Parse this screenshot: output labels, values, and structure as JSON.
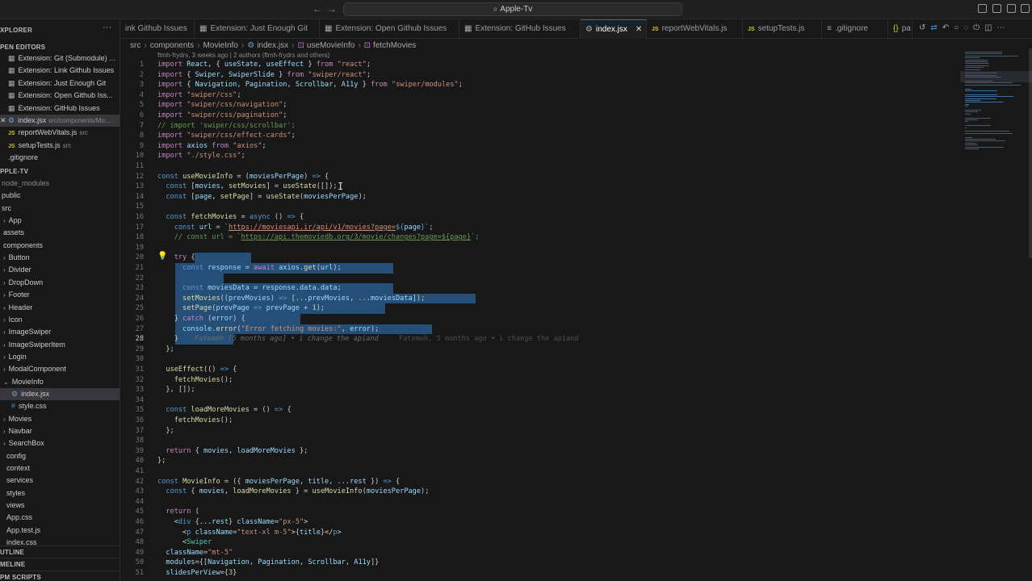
{
  "window": {
    "title": "Apple-Tv"
  },
  "sidebar": {
    "explorer_title": "XPLORER",
    "open_editors_title": "PEN EDITORS",
    "open_editors": [
      {
        "label": "Extension: Git (Submodule) ...",
        "desc": "",
        "icon": "ext"
      },
      {
        "label": "Extension: Link Github Issues",
        "desc": "",
        "icon": "ext"
      },
      {
        "label": "Extension: Just Enough Git",
        "desc": "",
        "icon": "ext"
      },
      {
        "label": "Extension: Open Github Iss...",
        "desc": "",
        "icon": "ext"
      },
      {
        "label": "Extension: GitHub Issues",
        "desc": "",
        "icon": "ext"
      },
      {
        "label": "index.jsx",
        "desc": "src/components/Mo...",
        "icon": "gear",
        "active": true
      },
      {
        "label": "reportWebVitals.js",
        "desc": "src",
        "icon": "js"
      },
      {
        "label": "setupTests.js",
        "desc": "src",
        "icon": "js"
      },
      {
        "label": ".gitignore",
        "desc": "",
        "icon": "none"
      }
    ],
    "project_title": "PPLE-TV",
    "tree": [
      {
        "label": "node_modules",
        "dim": true
      },
      {
        "label": "public"
      },
      {
        "label": "src"
      },
      {
        "label": "App",
        "chev": true
      },
      {
        "label": "assets"
      },
      {
        "label": "components"
      },
      {
        "label": "Button",
        "chev": true
      },
      {
        "label": "Divider",
        "chev": true
      },
      {
        "label": "DropDown",
        "chev": true
      },
      {
        "label": "Footer",
        "chev": true
      },
      {
        "label": "Header",
        "chev": true
      },
      {
        "label": "Icon",
        "chev": true
      },
      {
        "label": "ImageSwiper",
        "chev": true
      },
      {
        "label": "ImageSwiperItem",
        "chev": true
      },
      {
        "label": "Login",
        "chev": true
      },
      {
        "label": "ModalComponent",
        "chev": true
      },
      {
        "label": "MovieInfo",
        "chev": "open"
      },
      {
        "label": "index.jsx",
        "icon": "gear",
        "active": true
      },
      {
        "label": "style.css",
        "icon": "hash"
      },
      {
        "label": "Movies",
        "chev": true
      },
      {
        "label": "Navbar",
        "chev": true
      },
      {
        "label": "SearchBox",
        "chev": true
      },
      {
        "label": "config"
      },
      {
        "label": "context"
      },
      {
        "label": "services"
      },
      {
        "label": "styles"
      },
      {
        "label": "views"
      },
      {
        "label": "App.css"
      },
      {
        "label": "App.test.js"
      },
      {
        "label": "index.css"
      }
    ],
    "outline_title": "UTLINE",
    "timeline_title": "MELINE",
    "npm_title": "PM SCRIPTS"
  },
  "tabs": [
    {
      "label": "ink Github Issues",
      "icon": "",
      "active": false
    },
    {
      "label": "Extension: Just Enough Git",
      "icon": "ext",
      "active": false
    },
    {
      "label": "Extension: Open Github Issues",
      "icon": "ext",
      "active": false
    },
    {
      "label": "Extension: GitHub Issues",
      "icon": "ext",
      "active": false
    },
    {
      "label": "index.jsx",
      "icon": "gear",
      "active": true
    },
    {
      "label": "reportWebVitals.js",
      "icon": "js",
      "active": false
    },
    {
      "label": "setupTests.js",
      "icon": "js",
      "active": false
    },
    {
      "label": ".gitignore",
      "icon": "list",
      "active": false
    },
    {
      "label": "pa",
      "icon": "braces",
      "active": false
    }
  ],
  "breadcrumb": [
    "src",
    "components",
    "MovieInfo",
    "index.jsx",
    "useMovieInfo",
    "fetchMovies"
  ],
  "blame_header": "ftmh-frydrs, 3 weeks ago | 2 authors (ftmh-frydrs and others)",
  "editor": {
    "current_line": 28,
    "inline_blame": "Fatemeh [5 months ago] • i change the apiand",
    "hover_blame": "Fatemeh, 5 months ago • i change the apiand",
    "lines": [
      {
        "n": 1,
        "html": "<span class='kc'>import</span> <span class='v'>React</span>, <span class='p'>{</span> <span class='v'>useState</span>, <span class='v'>useEffect</span> <span class='p'>}</span> <span class='kc'>from</span> <span class='s'>\"react\"</span>;"
      },
      {
        "n": 2,
        "html": "<span class='kc'>import</span> <span class='p'>{</span> <span class='v'>Swiper</span>, <span class='v'>SwiperSlide</span> <span class='p'>}</span> <span class='kc'>from</span> <span class='s'>\"swiper/react\"</span>;"
      },
      {
        "n": 3,
        "html": "<span class='kc'>import</span> <span class='p'>{</span> <span class='v'>Navigation</span>, <span class='v'>Pagination</span>, <span class='v'>Scrollbar</span>, <span class='v'>A11y</span> <span class='p'>}</span> <span class='kc'>from</span> <span class='s'>\"swiper/modules\"</span>;"
      },
      {
        "n": 4,
        "html": "<span class='kc'>import</span> <span class='s'>\"swiper/css\"</span>;"
      },
      {
        "n": 5,
        "html": "<span class='kc'>import</span> <span class='s'>\"swiper/css/navigation\"</span>;"
      },
      {
        "n": 6,
        "html": "<span class='kc'>import</span> <span class='s'>\"swiper/css/pagination\"</span>;"
      },
      {
        "n": 7,
        "html": "<span class='c'>// import 'swiper/css/scrollbar';</span>"
      },
      {
        "n": 8,
        "html": "<span class='kc'>import</span> <span class='s'>\"swiper/css/effect-cards\"</span>;"
      },
      {
        "n": 9,
        "html": "<span class='kc'>import</span> <span class='v'>axios</span> <span class='kc'>from</span> <span class='s'>\"axios\"</span>;"
      },
      {
        "n": 10,
        "html": "<span class='kc'>import</span> <span class='s'>\"./style.css\"</span>;"
      },
      {
        "n": 11,
        "html": ""
      },
      {
        "n": 12,
        "html": "<span class='k'>const</span> <span class='f'>useMovieInfo</span> = (<span class='v'>moviesPerPage</span>) <span class='k'>=&gt;</span> {"
      },
      {
        "n": 13,
        "html": "  <span class='k'>const</span> [<span class='v'>movies</span>, <span class='f'>setMovies</span>] = <span class='f'>useState</span>([]);"
      },
      {
        "n": 14,
        "html": "  <span class='k'>const</span> [<span class='v'>page</span>, <span class='f'>setPage</span>] = <span class='f'>useState</span>(<span class='v'>moviesPerPage</span>);"
      },
      {
        "n": 15,
        "html": ""
      },
      {
        "n": 16,
        "html": "  <span class='k'>const</span> <span class='f'>fetchMovies</span> = <span class='k'>async</span> () <span class='k'>=&gt;</span> {"
      },
      {
        "n": 17,
        "html": "    <span class='k'>const</span> <span class='v'>url</span> = <span class='s'>`<u>https://moviesapi.ir/api/v1/movies?page=</u></span><span class='k'>${</span><span class='v'>page</span><span class='k'>}</span><span class='s'>`</span>;"
      },
      {
        "n": 18,
        "html": "    <span class='c'>// const url = `<u>https://api.themoviedb.org/3/movie/changes?page=${page}</u>`;</span>"
      },
      {
        "n": 19,
        "html": ""
      },
      {
        "n": 20,
        "html": "    <span class='kc'>try</span> {",
        "sel": [
          46,
          70
        ]
      },
      {
        "n": 21,
        "html": "      <span class='k'>const</span> <span class='v'>response</span> = <span class='kc'>await</span> <span class='v'>axios</span>.<span class='f'>get</span>(<span class='v'>url</span>);",
        "sel": [
          22,
          270
        ]
      },
      {
        "n": 22,
        "html": "",
        "sel": [
          22,
          60
        ]
      },
      {
        "n": 23,
        "html": "      <span class='k'>const</span> <span class='v'>moviesData</span> = <span class='v'>response</span>.<span class='v'>data</span>.<span class='v'>data</span>;",
        "sel": [
          22,
          270
        ]
      },
      {
        "n": 24,
        "html": "      <span class='f'>setMovies</span>((<span class='v'>prevMovies</span>) <span class='k'>=&gt;</span> [...<span class='v'>prevMovies</span>, ...<span class='v'>moviesData</span>]);",
        "sel": [
          22,
          372
        ]
      },
      {
        "n": 25,
        "html": "      <span class='f'>setPage</span>(<span class='v'>prevPage</span> <span class='k'>=&gt;</span> <span class='v'>prevPage</span> + <span class='n'>1</span>);",
        "sel": [
          22,
          260
        ]
      },
      {
        "n": 26,
        "html": "    } <span class='kc'>catch</span> (<span class='v'>error</span>) {",
        "sel": [
          22,
          155
        ]
      },
      {
        "n": 27,
        "html": "      <span class='v'>console</span>.<span class='f'>error</span>(<span class='s'>\"Error fetching movies:\"</span>, <span class='v'>error</span>);",
        "sel": [
          22,
          318
        ]
      },
      {
        "n": 28,
        "html": "    }",
        "sel": [
          22,
          72
        ],
        "blame": true
      },
      {
        "n": 29,
        "html": "  };"
      },
      {
        "n": 30,
        "html": ""
      },
      {
        "n": 31,
        "html": "  <span class='f'>useEffect</span>(() <span class='k'>=&gt;</span> {"
      },
      {
        "n": 32,
        "html": "    <span class='f'>fetchMovies</span>();"
      },
      {
        "n": 33,
        "html": "  }, []);"
      },
      {
        "n": 34,
        "html": ""
      },
      {
        "n": 35,
        "html": "  <span class='k'>const</span> <span class='f'>loadMoreMovies</span> = () <span class='k'>=&gt;</span> {"
      },
      {
        "n": 36,
        "html": "    <span class='f'>fetchMovies</span>();"
      },
      {
        "n": 37,
        "html": "  };"
      },
      {
        "n": 38,
        "html": ""
      },
      {
        "n": 39,
        "html": "  <span class='kc'>return</span> { <span class='v'>movies</span>, <span class='v'>loadMoreMovies</span> };"
      },
      {
        "n": 40,
        "html": "};"
      },
      {
        "n": 41,
        "html": ""
      },
      {
        "n": 42,
        "html": "<span class='k'>const</span> <span class='f'>MovieInfo</span> = ({ <span class='v'>moviesPerPage</span>, <span class='v'>title</span>, ...<span class='v'>rest</span> }) <span class='k'>=&gt;</span> {"
      },
      {
        "n": 43,
        "html": "  <span class='k'>const</span> { <span class='v'>movies</span>, <span class='f'>loadMoreMovies</span> } = <span class='f'>useMovieInfo</span>(<span class='v'>moviesPerPage</span>);"
      },
      {
        "n": 44,
        "html": ""
      },
      {
        "n": 45,
        "html": "  <span class='kc'>return</span> ("
      },
      {
        "n": 46,
        "html": "    <span class='p'>&lt;</span><span class='k'>div</span> {...<span class='v'>rest</span>} <span class='v'>className</span>=<span class='s'>\"px-5\"</span><span class='p'>&gt;</span>"
      },
      {
        "n": 47,
        "html": "      <span class='p'>&lt;</span><span class='k'>p</span> <span class='v'>className</span>=<span class='s'>\"text-xl m-5\"</span><span class='p'>&gt;</span>{<span class='v'>title</span>}<span class='p'>&lt;/</span><span class='k'>p</span><span class='p'>&gt;</span>"
      },
      {
        "n": 48,
        "html": "      <span class='p'>&lt;</span><span class='t'>Swiper</span>"
      },
      {
        "n": 49,
        "html": "  <span class='v'>className</span>=<span class='s'>\"mt-5\"</span>"
      },
      {
        "n": 50,
        "html": "  <span class='v'>modules</span>={[<span class='v'>Navigation</span>, <span class='v'>Pagination</span>, <span class='v'>Scrollbar</span>, <span class='v'>A11y</span>]}"
      },
      {
        "n": 51,
        "html": "  <span class='v'>slidesPerView</span>={<span class='n'>3</span>}"
      }
    ]
  },
  "colors": {
    "accent": "#0078d4",
    "selection": "#264f78",
    "background": "#181818"
  }
}
